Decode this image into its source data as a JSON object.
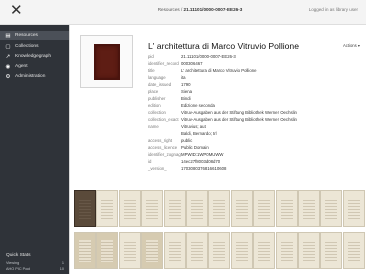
{
  "topbar": {
    "close_glyph": "✕",
    "breadcrumb_prefix": "Resources /",
    "breadcrumb_id": "21.11101/0000-0007-EE26-3",
    "login": "Logged in as library user"
  },
  "sidebar": {
    "items": [
      {
        "label": "Resources",
        "icon": "resources-icon",
        "glyph": "▤"
      },
      {
        "label": "Collections",
        "icon": "collections-icon",
        "glyph": "▢"
      },
      {
        "label": "Knowledgegraph",
        "icon": "graph-icon",
        "glyph": "↗"
      },
      {
        "label": "Agent",
        "icon": "agent-icon",
        "glyph": "◉"
      },
      {
        "label": "Administration",
        "icon": "gear-icon",
        "glyph": "⚙"
      }
    ],
    "quick_stats_title": "Quick Stats",
    "quick_stats": [
      {
        "label": "Viewing",
        "value": "1"
      },
      {
        "label": "AHO PIC Pool",
        "value": "10"
      }
    ]
  },
  "record": {
    "title": "L' architettura di Marco Vitruvio Pollione",
    "actions_label": "Actions ▾",
    "fields": [
      {
        "key": "pid",
        "value": "21.11101/0000-0007-EE26-3"
      },
      {
        "key": "identifier_record",
        "value": "000306467"
      },
      {
        "key": "title",
        "value": "L' architettura di Marco Vitruvio Pollione"
      },
      {
        "key": "language",
        "value": "ita"
      },
      {
        "key": "date_issued",
        "value": "1790"
      },
      {
        "key": "place",
        "value": "Siena"
      },
      {
        "key": "publisher",
        "value": "Bindi"
      },
      {
        "key": "edition",
        "value": "Edizione seconda"
      },
      {
        "key": "collection",
        "value": "Vitruv-Ausgaben aus der Stiftung Bibliothek Werner Oechslin"
      },
      {
        "key": "collection_exact",
        "value": "Vitruv-Ausgaben aus der Stiftung Bibliothek Werner Oechslin"
      },
      {
        "key": "name",
        "value": "Vitruvius; aut"
      },
      {
        "key": "",
        "value": "Baldi, Bernardo; trl"
      },
      {
        "key": "access_right",
        "value": "public"
      },
      {
        "key": "access_licence",
        "value": "Public Domain"
      },
      {
        "key": "identifier_zognag",
        "value": "MPWID:1WP0MUWW"
      },
      {
        "key": "id",
        "value": "14ec27f8003d08d70"
      },
      {
        "key": "_version_",
        "value": "1703080376816610608"
      }
    ]
  },
  "pages": {
    "row1_styles": [
      "dark",
      "light",
      "light",
      "light",
      "light",
      "light",
      "light",
      "light",
      "light",
      "light",
      "light",
      "light",
      "light"
    ],
    "row2_styles": [
      "tan",
      "tan",
      "light",
      "tan",
      "light",
      "light",
      "light",
      "light",
      "light",
      "light",
      "light",
      "light",
      "light"
    ]
  }
}
